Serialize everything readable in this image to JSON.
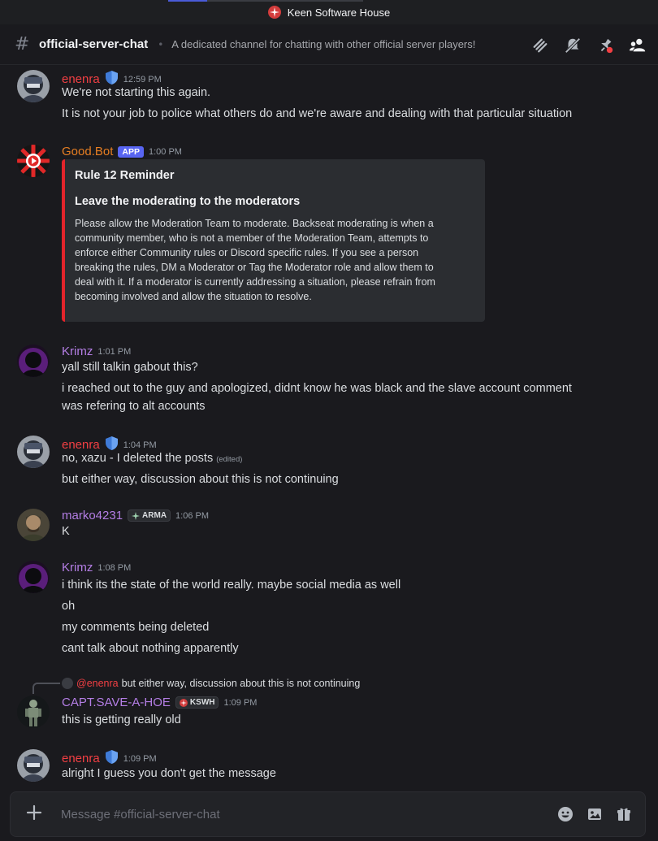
{
  "window": {
    "title": "Keen Software House"
  },
  "header": {
    "channel_name": "official-server-chat",
    "topic": "A dedicated channel for chatting with other official server players!",
    "icons": [
      "threads-icon",
      "mute-icon",
      "pin-icon",
      "members-icon"
    ]
  },
  "colors": {
    "mod_name": "#f23f43",
    "bot_name": "#e67e22",
    "member_name": "#b47ee5",
    "embed_border": "#e3242b",
    "app_badge": "#5865f2"
  },
  "messages": [
    {
      "author": "enenra",
      "badge": "shield-icon",
      "time": "12:59 PM",
      "lines": [
        "We're not starting this again.",
        "It is not your job to police what others do and we're aware and dealing with that particular situation"
      ]
    },
    {
      "author": "Good.Bot",
      "badge": "APP",
      "time": "1:00 PM",
      "embed": {
        "title": "Rule 12 Reminder",
        "subtitle": "Leave the moderating to the moderators",
        "body_lines": [
          "Please allow the Moderation Team to moderate. Backseat moderating is when a",
          "community member, who is not a member of the Moderation Team, attempts to",
          "enforce either Community rules or Discord specific rules. If you see a person",
          "breaking the rules, DM a Moderator or Tag the Moderator role and allow them to",
          "deal with it. If a moderator is currently addressing a situation, please refrain from",
          "becoming involved and allow the situation to resolve."
        ]
      }
    },
    {
      "author": "Krimz",
      "time": "1:01 PM",
      "lines": [
        "yall still talkin gabout this?",
        "i reached out to the guy and apologized, didnt know he was black and the slave account comment",
        "was refering to alt accounts"
      ]
    },
    {
      "author": "enenra",
      "badge": "shield-icon",
      "time": "1:04 PM",
      "lines": [
        "no, xazu - I deleted the posts",
        "but either way, discussion about this is not continuing"
      ],
      "edited": "(edited)"
    },
    {
      "author": "marko4231",
      "tag": "ARMA",
      "time": "1:06 PM",
      "lines": [
        "K"
      ]
    },
    {
      "author": "Krimz",
      "time": "1:08 PM",
      "lines": [
        "i think its the state of the world really. maybe social media as well",
        "oh",
        "my comments being deleted",
        "cant talk about nothing apparently"
      ]
    },
    {
      "author": "CAPT.SAVE-A-HOE",
      "tag": "KSWH",
      "time": "1:09 PM",
      "reply": {
        "mention": "@enenra",
        "text": "but either way, discussion about this is not continuing"
      },
      "lines": [
        "this is getting really old"
      ]
    },
    {
      "author": "enenra",
      "badge": "shield-icon",
      "time": "1:09 PM",
      "lines": [
        "alright I guess you don't get the message"
      ]
    }
  ],
  "composer": {
    "placeholder": "Message #official-server-chat",
    "icons": [
      "plus-icon",
      "emoji-icon",
      "image-icon",
      "gift-icon"
    ]
  }
}
